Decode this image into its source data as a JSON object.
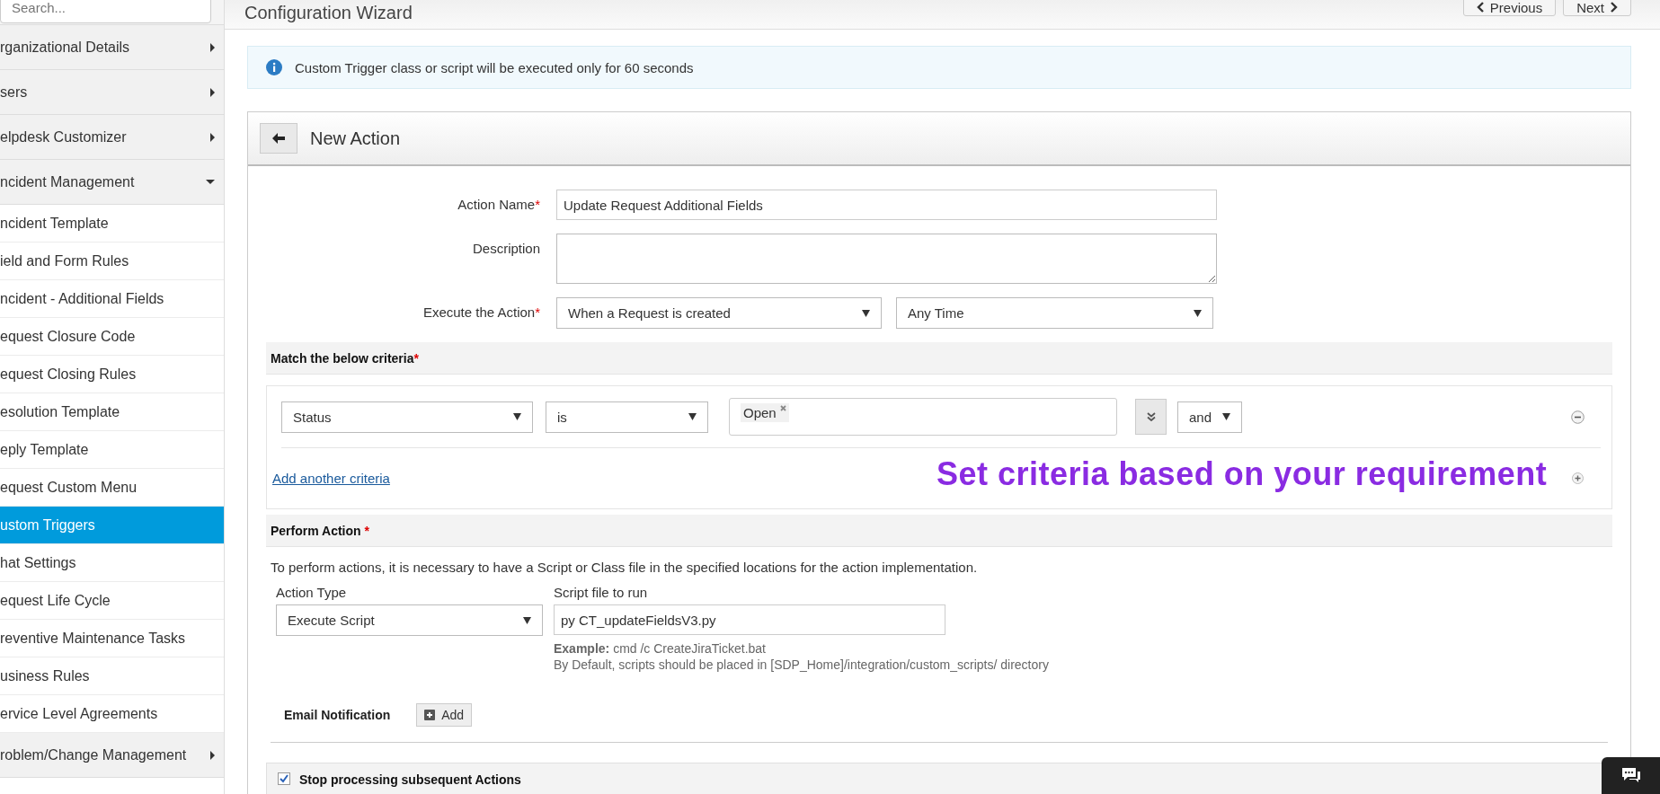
{
  "sidebar": {
    "search": {
      "placeholder": "Search..."
    },
    "items": [
      {
        "kind": "group",
        "label": "rganizational Details",
        "expanded": false,
        "selected": false
      },
      {
        "kind": "group",
        "label": "sers",
        "expanded": false,
        "selected": false
      },
      {
        "kind": "group",
        "label": "elpdesk Customizer",
        "expanded": false,
        "selected": false
      },
      {
        "kind": "group",
        "label": "ncident Management",
        "expanded": true,
        "selected": false
      },
      {
        "kind": "item",
        "label": "ncident Template",
        "selected": false
      },
      {
        "kind": "item",
        "label": "ield and Form Rules",
        "selected": false
      },
      {
        "kind": "item",
        "label": "ncident - Additional Fields",
        "selected": false
      },
      {
        "kind": "item",
        "label": "equest Closure Code",
        "selected": false
      },
      {
        "kind": "item",
        "label": "equest Closing Rules",
        "selected": false
      },
      {
        "kind": "item",
        "label": "esolution Template",
        "selected": false
      },
      {
        "kind": "item",
        "label": "eply Template",
        "selected": false
      },
      {
        "kind": "item",
        "label": "equest Custom Menu",
        "selected": false
      },
      {
        "kind": "item",
        "label": "ustom Triggers",
        "selected": true
      },
      {
        "kind": "item",
        "label": "hat Settings",
        "selected": false
      },
      {
        "kind": "item",
        "label": "equest Life Cycle",
        "selected": false
      },
      {
        "kind": "item",
        "label": "reventive Maintenance Tasks",
        "selected": false
      },
      {
        "kind": "item",
        "label": "usiness Rules",
        "selected": false
      },
      {
        "kind": "item",
        "label": "ervice Level Agreements",
        "selected": false
      },
      {
        "kind": "group",
        "label": "roblem/Change Management",
        "expanded": false,
        "selected": false
      }
    ]
  },
  "header": {
    "title": "Configuration Wizard",
    "buttons": [
      "Previous",
      "Next"
    ]
  },
  "info": "Custom Trigger class or script will be executed only for 60 seconds",
  "panel": {
    "title": "New Action",
    "action_name": {
      "label": "Action Name",
      "required": "*",
      "value": "Update Request Additional Fields"
    },
    "description": {
      "label": "Description"
    },
    "execute": {
      "label": "Execute the Action",
      "required": "*",
      "when": "When a Request is created",
      "time": "Any Time"
    },
    "criteria": {
      "title": "Match the below criteria",
      "required": "*",
      "field": "Status",
      "operator": "is",
      "values": [
        "Open"
      ],
      "joiner": "and",
      "add_link": "Add another criteria"
    },
    "perform": {
      "title": "Perform Action",
      "required": "*",
      "note": "To perform actions, it is necessary to have a Script or Class file in the specified locations for the action implementation.",
      "action_type_label": "Action Type",
      "action_type": "Execute Script",
      "script_label": "Script file to run",
      "script": "py CT_updateFieldsV3.py",
      "example": "**Example:** cmd /c CreateJiraTicket.bat",
      "hint": "By Default, scripts should be placed in [SDP_Home]/integration/custom_scripts/ directory"
    },
    "email": {
      "label": "Email Notification",
      "button": "Add"
    },
    "stop": {
      "label": "Stop processing subsequent Actions",
      "checked": true
    }
  },
  "annotation": "Set criteria based on your requirement"
}
